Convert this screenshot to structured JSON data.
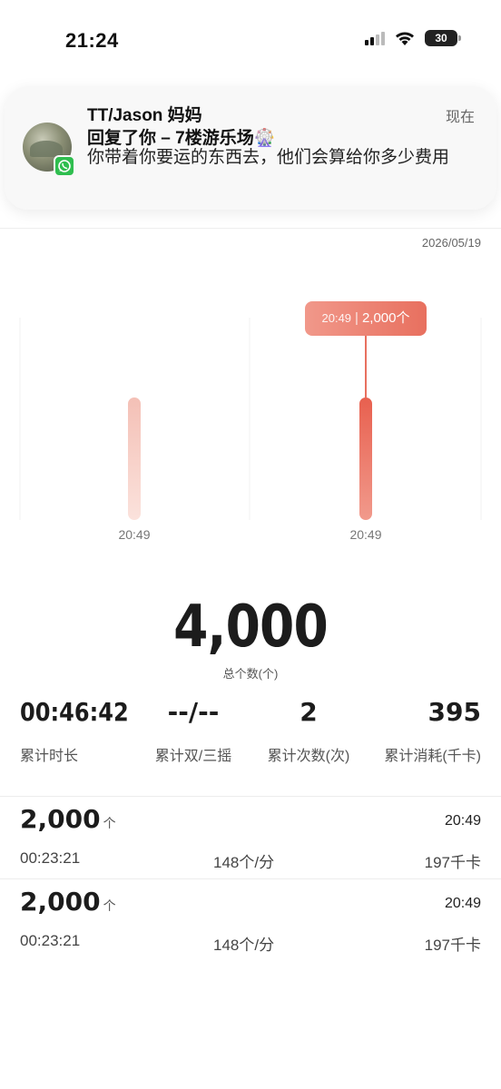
{
  "status_bar": {
    "time": "21:24",
    "battery": "30"
  },
  "notification": {
    "sender": "TT/Jason 妈妈",
    "time": "现在",
    "subtitle": "回复了你 – 7楼游乐场🎡",
    "message": "你带着你要运的东西去，他们会算给你多少费用"
  },
  "date": "2026/05/19",
  "chart_data": {
    "type": "bar",
    "categories": [
      "20:49",
      "20:49"
    ],
    "values": [
      2000,
      2000
    ],
    "selected_index": 1,
    "tooltip": {
      "time": "20:49",
      "value": "2,000个"
    },
    "colors": {
      "inactive": "#f4c4bb",
      "active": "#e8604f"
    }
  },
  "summary": {
    "total": "4,000",
    "total_label": "总个数(个)"
  },
  "stats": [
    {
      "value": "00:46:42",
      "label": "累计时长"
    },
    {
      "value": "--/--",
      "label": "累计双/三摇"
    },
    {
      "value": "2",
      "label": "累计次数(次)"
    },
    {
      "value": "395",
      "label": "累计消耗(千卡)"
    }
  ],
  "records": [
    {
      "count": "2,000",
      "unit": "个",
      "time": "20:49",
      "duration": "00:23:21",
      "rate": "148个/分",
      "calories": "197千卡"
    },
    {
      "count": "2,000",
      "unit": "个",
      "time": "20:49",
      "duration": "00:23:21",
      "rate": "148个/分",
      "calories": "197千卡"
    }
  ]
}
